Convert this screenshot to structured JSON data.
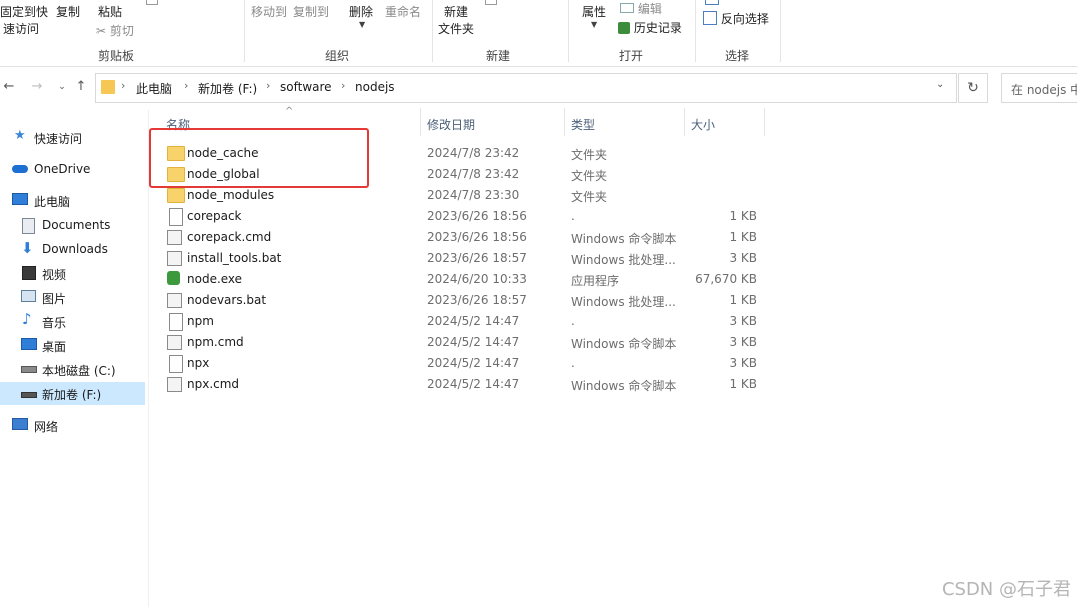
{
  "ribbon": {
    "clipboard": {
      "pin_label_1": "固定到快",
      "pin_label_2": "速访问",
      "copy": "复制",
      "paste": "粘贴",
      "cut": "剪切",
      "group": "剪贴板"
    },
    "organize": {
      "move_to": "移动到",
      "copy_to": "复制到",
      "delete": "删除",
      "rename": "重命名",
      "group": "组织"
    },
    "new": {
      "new_folder_1": "新建",
      "new_folder_2": "文件夹",
      "group": "新建"
    },
    "open": {
      "properties": "属性",
      "edit": "编辑",
      "history": "历史记录",
      "group": "打开"
    },
    "select": {
      "invert": "反向选择",
      "group": "选择"
    }
  },
  "address": {
    "crumbs": [
      "此电脑",
      "新加卷 (F:)",
      "software",
      "nodejs"
    ],
    "search_placeholder": "在 nodejs 中"
  },
  "nav": {
    "items": [
      {
        "label": "快速访问",
        "icon": "star-icon"
      },
      {
        "label": "OneDrive",
        "icon": "cloud-icon"
      },
      {
        "label": "此电脑",
        "icon": "pc-icon"
      },
      {
        "label": "Documents",
        "icon": "document-icon"
      },
      {
        "label": "Downloads",
        "icon": "download-icon"
      },
      {
        "label": "视频",
        "icon": "video-icon"
      },
      {
        "label": "图片",
        "icon": "picture-icon"
      },
      {
        "label": "音乐",
        "icon": "music-icon"
      },
      {
        "label": "桌面",
        "icon": "desktop-icon"
      },
      {
        "label": "本地磁盘 (C:)",
        "icon": "drive-icon"
      },
      {
        "label": "新加卷 (F:)",
        "icon": "drive-icon"
      },
      {
        "label": "网络",
        "icon": "network-icon"
      }
    ]
  },
  "columns": {
    "name": "名称",
    "date": "修改日期",
    "type": "类型",
    "size": "大小"
  },
  "files": [
    {
      "name": "node_cache",
      "date": "2024/7/8 23:42",
      "type": "文件夹",
      "size": "",
      "icon": "folder-icon"
    },
    {
      "name": "node_global",
      "date": "2024/7/8 23:42",
      "type": "文件夹",
      "size": "",
      "icon": "folder-icon"
    },
    {
      "name": "node_modules",
      "date": "2024/7/8 23:30",
      "type": "文件夹",
      "size": "",
      "icon": "folder-icon"
    },
    {
      "name": "corepack",
      "date": "2023/6/26 18:56",
      "type": ".",
      "size": "1 KB",
      "icon": "file-icon"
    },
    {
      "name": "corepack.cmd",
      "date": "2023/6/26 18:56",
      "type": "Windows 命令脚本",
      "size": "1 KB",
      "icon": "script-icon"
    },
    {
      "name": "install_tools.bat",
      "date": "2023/6/26 18:57",
      "type": "Windows 批处理...",
      "size": "3 KB",
      "icon": "script-icon"
    },
    {
      "name": "node.exe",
      "date": "2024/6/20 10:33",
      "type": "应用程序",
      "size": "67,670 KB",
      "icon": "nodejs-icon"
    },
    {
      "name": "nodevars.bat",
      "date": "2023/6/26 18:57",
      "type": "Windows 批处理...",
      "size": "1 KB",
      "icon": "script-icon"
    },
    {
      "name": "npm",
      "date": "2024/5/2 14:47",
      "type": ".",
      "size": "3 KB",
      "icon": "file-icon"
    },
    {
      "name": "npm.cmd",
      "date": "2024/5/2 14:47",
      "type": "Windows 命令脚本",
      "size": "3 KB",
      "icon": "script-icon"
    },
    {
      "name": "npx",
      "date": "2024/5/2 14:47",
      "type": ".",
      "size": "3 KB",
      "icon": "file-icon"
    },
    {
      "name": "npx.cmd",
      "date": "2024/5/2 14:47",
      "type": "Windows 命令脚本",
      "size": "1 KB",
      "icon": "script-icon"
    }
  ],
  "watermark": "CSDN @石子君"
}
